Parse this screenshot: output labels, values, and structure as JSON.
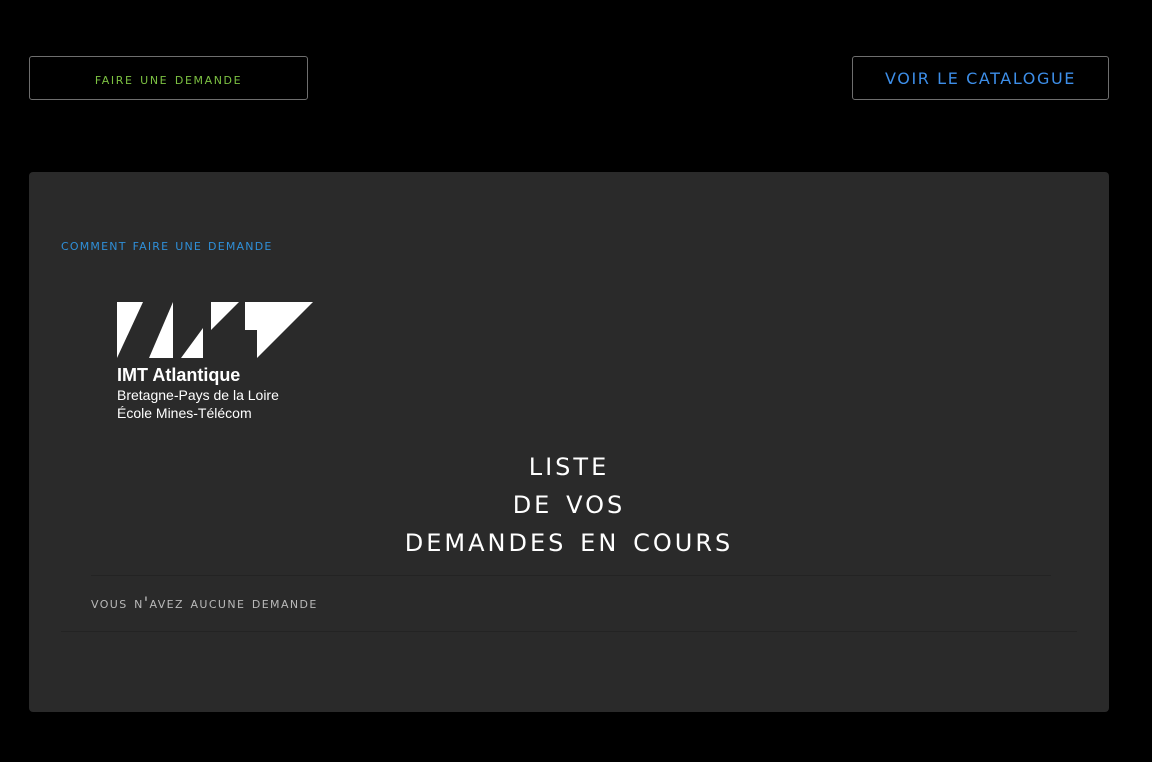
{
  "topbar": {
    "make_request_label": "Faire une demande",
    "catalogue_label": "VOIR LE CATALOGUE"
  },
  "panel": {
    "howto_link": "comment faire une demande",
    "logo": {
      "title": "IMT Atlantique",
      "line1": "Bretagne-Pays de la Loire",
      "line2": "École Mines-Télécom"
    },
    "heading": {
      "line1": "Liste",
      "line2": "de vos",
      "line3": "demandes en cours"
    },
    "empty_message": "Vous n'avez aucune demande"
  },
  "colors": {
    "background": "#000000",
    "panel": "#2a2a2a",
    "make_request_text": "#7cc142",
    "catalogue_text": "#3d8ee8",
    "link": "#2f8fd8",
    "heading": "#ffffff",
    "muted_text": "#b9b9b9"
  }
}
